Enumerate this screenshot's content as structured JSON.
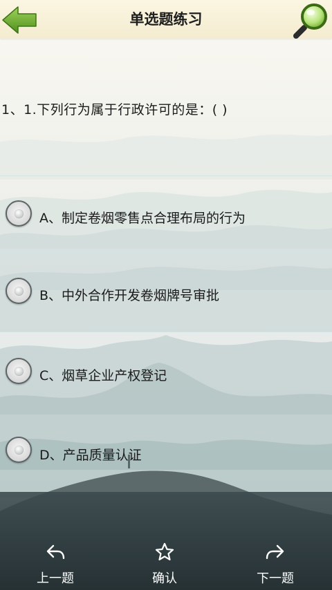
{
  "header": {
    "title": "单选题练习",
    "back_icon": "back-arrow-icon",
    "search_icon": "magnifier-icon"
  },
  "question": {
    "text": "1、1.下列行为属于行政许可的是：(    )"
  },
  "options": [
    {
      "label": "A、制定卷烟零售点合理布局的行为"
    },
    {
      "label": "B、中外合作开发卷烟牌号审批"
    },
    {
      "label": "C、烟草企业产权登记"
    },
    {
      "label": "D、产品质量认证"
    }
  ],
  "bottom_nav": {
    "prev": {
      "label": "上一题",
      "icon": "reply-arrow-icon"
    },
    "confirm": {
      "label": "确认",
      "icon": "star-icon"
    },
    "next": {
      "label": "下一题",
      "icon": "forward-arrow-icon"
    }
  },
  "colors": {
    "header_bg": "#f8f1da",
    "back_arrow": "#6cab2c",
    "text": "#1a1a1a",
    "bottom_bar": "#2e3c40"
  }
}
